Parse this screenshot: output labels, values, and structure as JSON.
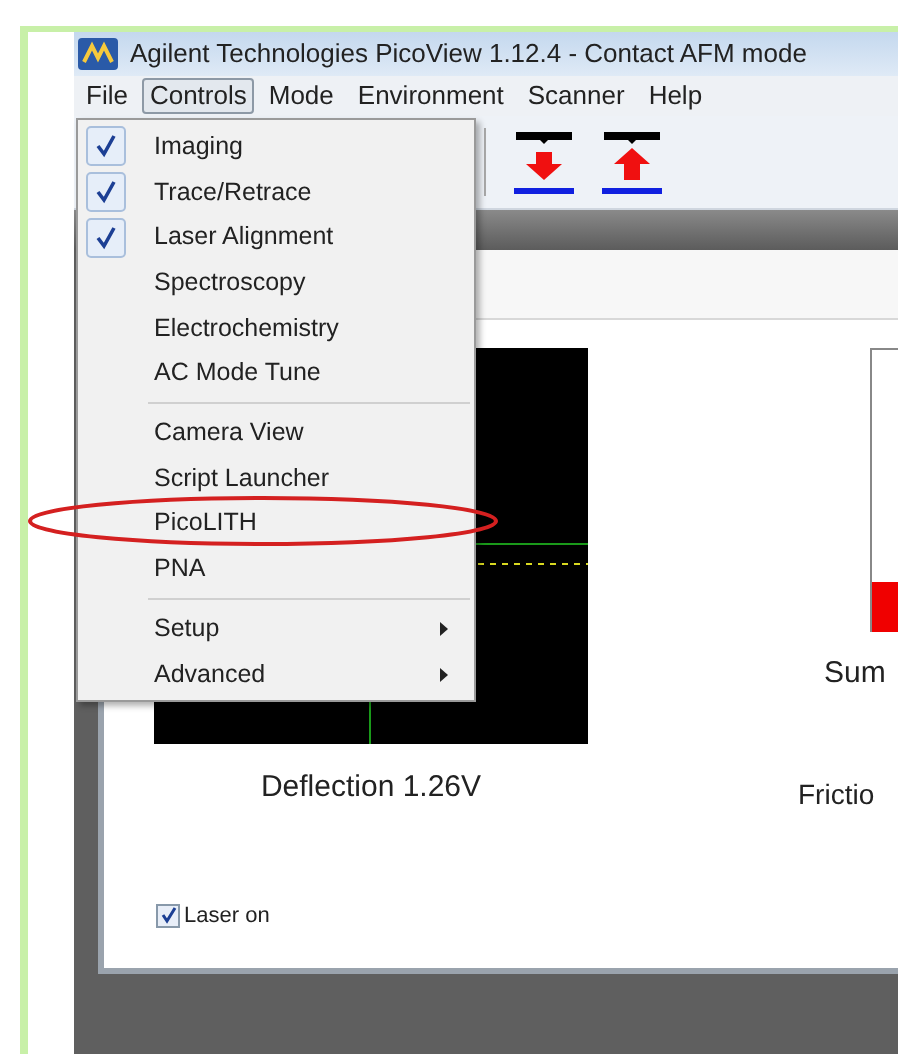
{
  "window": {
    "title": "Agilent Technologies PicoView 1.12.4 - Contact AFM mode"
  },
  "menu_bar": [
    {
      "label": "File",
      "selected": false
    },
    {
      "label": "Controls",
      "selected": true
    },
    {
      "label": "Mode",
      "selected": false
    },
    {
      "label": "Environment",
      "selected": false
    },
    {
      "label": "Scanner",
      "selected": false
    },
    {
      "label": "Help",
      "selected": false
    }
  ],
  "controls_menu": {
    "items": [
      {
        "kind": "item",
        "label": "Imaging",
        "checked": true
      },
      {
        "kind": "item",
        "label": "Trace/Retrace",
        "checked": true
      },
      {
        "kind": "item",
        "label": "Laser Alignment",
        "checked": true
      },
      {
        "kind": "item",
        "label": "Spectroscopy",
        "checked": false
      },
      {
        "kind": "item",
        "label": "Electrochemistry",
        "checked": false
      },
      {
        "kind": "item",
        "label": "AC Mode Tune",
        "checked": false
      },
      {
        "kind": "separator"
      },
      {
        "kind": "item",
        "label": "Camera View",
        "checked": false
      },
      {
        "kind": "item",
        "label": "Script Launcher",
        "checked": false
      },
      {
        "kind": "item",
        "label": "PicoLITH",
        "checked": false,
        "circled": true
      },
      {
        "kind": "item",
        "label": "PNA",
        "checked": false
      },
      {
        "kind": "separator"
      },
      {
        "kind": "submenu",
        "label": "Setup"
      },
      {
        "kind": "submenu",
        "label": "Advanced"
      }
    ]
  },
  "monitors": {
    "deflection": {
      "label": "Deflection 1.26V"
    },
    "sum": {
      "label": "Sum",
      "level": 0.18
    },
    "friction": {
      "label": "Frictio"
    }
  },
  "laser_on": {
    "label": "Laser on",
    "checked": true
  }
}
